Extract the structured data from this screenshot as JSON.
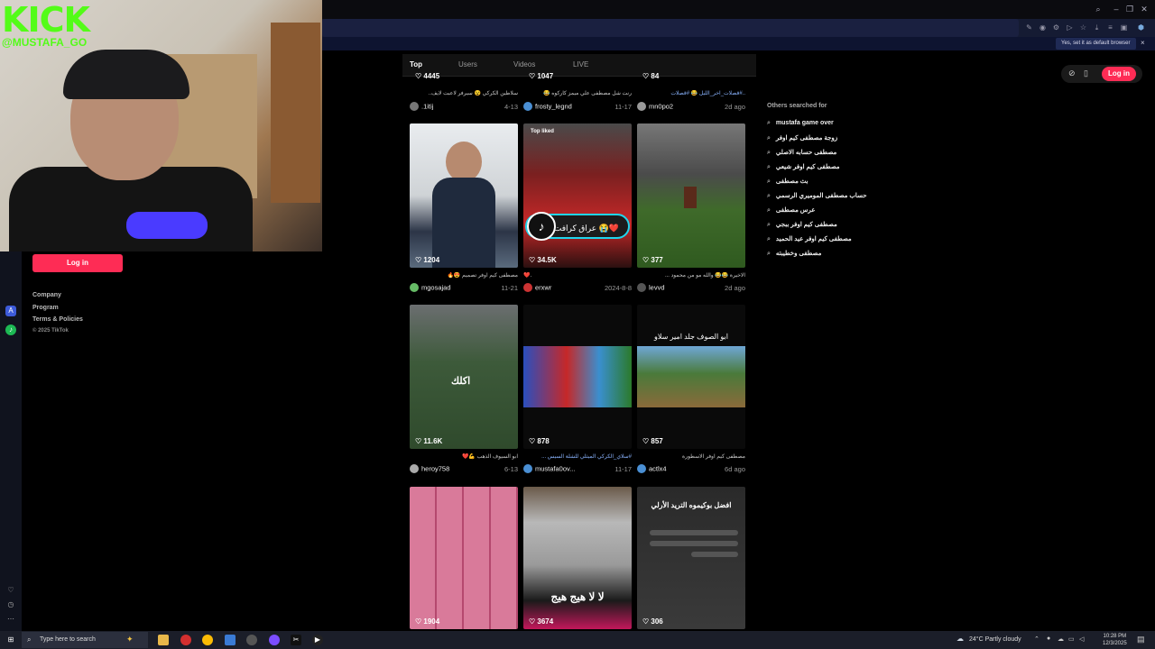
{
  "overlay": {
    "logo": "KICK",
    "handle": "@MUSTAFA_GO"
  },
  "browser": {
    "default_banner": "Yes, set it as default browser",
    "close": "×"
  },
  "sidebar": {
    "login": "Log in",
    "links": [
      "Company",
      "Program",
      "Terms & Policies"
    ],
    "copyright": "© 2025 TikTok"
  },
  "tabs": [
    "Top",
    "Users",
    "Videos",
    "LIVE"
  ],
  "top_row": [
    {
      "likes": "4445",
      "caption": "سلاطين الكركي 😵 سيرفر لاعبت لايف..",
      "user": ".1itij",
      "date": "4-13"
    },
    {
      "likes": "1047",
      "caption": "رنت شل مصطفى علي ميمز كاركوه 😂",
      "user": "frosty_legnd",
      "date": "11-17"
    },
    {
      "likes": "84",
      "caption": "..#قصلات_اخر_الليل 😂 #قصلات",
      "user": "mn0po2",
      "date": "2d ago"
    }
  ],
  "videos": [
    {
      "likes": "1204",
      "caption": "مصطفى كيم اوفر تصميم 😍🔥",
      "user": "mgosajad",
      "date": "11-21",
      "top_liked": ""
    },
    {
      "likes": "34.5K",
      "caption": "❤️.",
      "user": "erxwr",
      "date": "2024-8-8",
      "top_liked": "Top liked",
      "overlay": "عراق كرافت 😭❤️"
    },
    {
      "likes": "377",
      "caption": "الاخيرة 😂😂 والله مو من محمود ...",
      "user": "levvd",
      "date": "2d ago",
      "top_liked": ""
    },
    {
      "likes": "11.6K",
      "caption": "ابو السيوف الذهب 💪❤️",
      "user": "heroy758",
      "date": "6-13",
      "top_liked": "",
      "overlay": "اكلك"
    },
    {
      "likes": "878",
      "caption": "#سلاي_الكركي الميثلي للشلة السيس ...",
      "user": "mustafa0ov...",
      "date": "11-17",
      "top_liked": ""
    },
    {
      "likes": "857",
      "caption": "مصطفى كيم اوفر الاسطورة",
      "user": "actlx4",
      "date": "6d ago",
      "top_liked": "",
      "overlay": "ابو الصوف جلد امير سلاو"
    },
    {
      "likes": "1904",
      "caption": "",
      "user": "",
      "date": "",
      "top_liked": ""
    },
    {
      "likes": "3674",
      "caption": "",
      "user": "",
      "date": "",
      "top_liked": "",
      "overlay": "لا لا هيج هيج"
    },
    {
      "likes": "306",
      "caption": "",
      "user": "",
      "date": "",
      "top_liked": "",
      "overlay": "افضل بوكيموه التريد الأرلي"
    }
  ],
  "right": {
    "login": "Log in",
    "others_title": "Others searched for",
    "suggestions": [
      "mustafa game over",
      "زوجة مصطفى كيم اوفر",
      "مصطفى حسابه الاصلي",
      "مصطفى كيم اوفر شيعي",
      "بث مصطفى",
      "حساب مصطفى الموميري الرسمي",
      "عرس مصطفى",
      "مصطفى كيم اوفر ببجي",
      "مصطفى كيم اوفر عيد الحميد",
      "مصطفى وخطيبته"
    ]
  },
  "taskbar": {
    "search_placeholder": "Type here to search",
    "weather": "24°C  Partly cloudy",
    "time": "10:28 PM",
    "date": "12/3/2025"
  }
}
